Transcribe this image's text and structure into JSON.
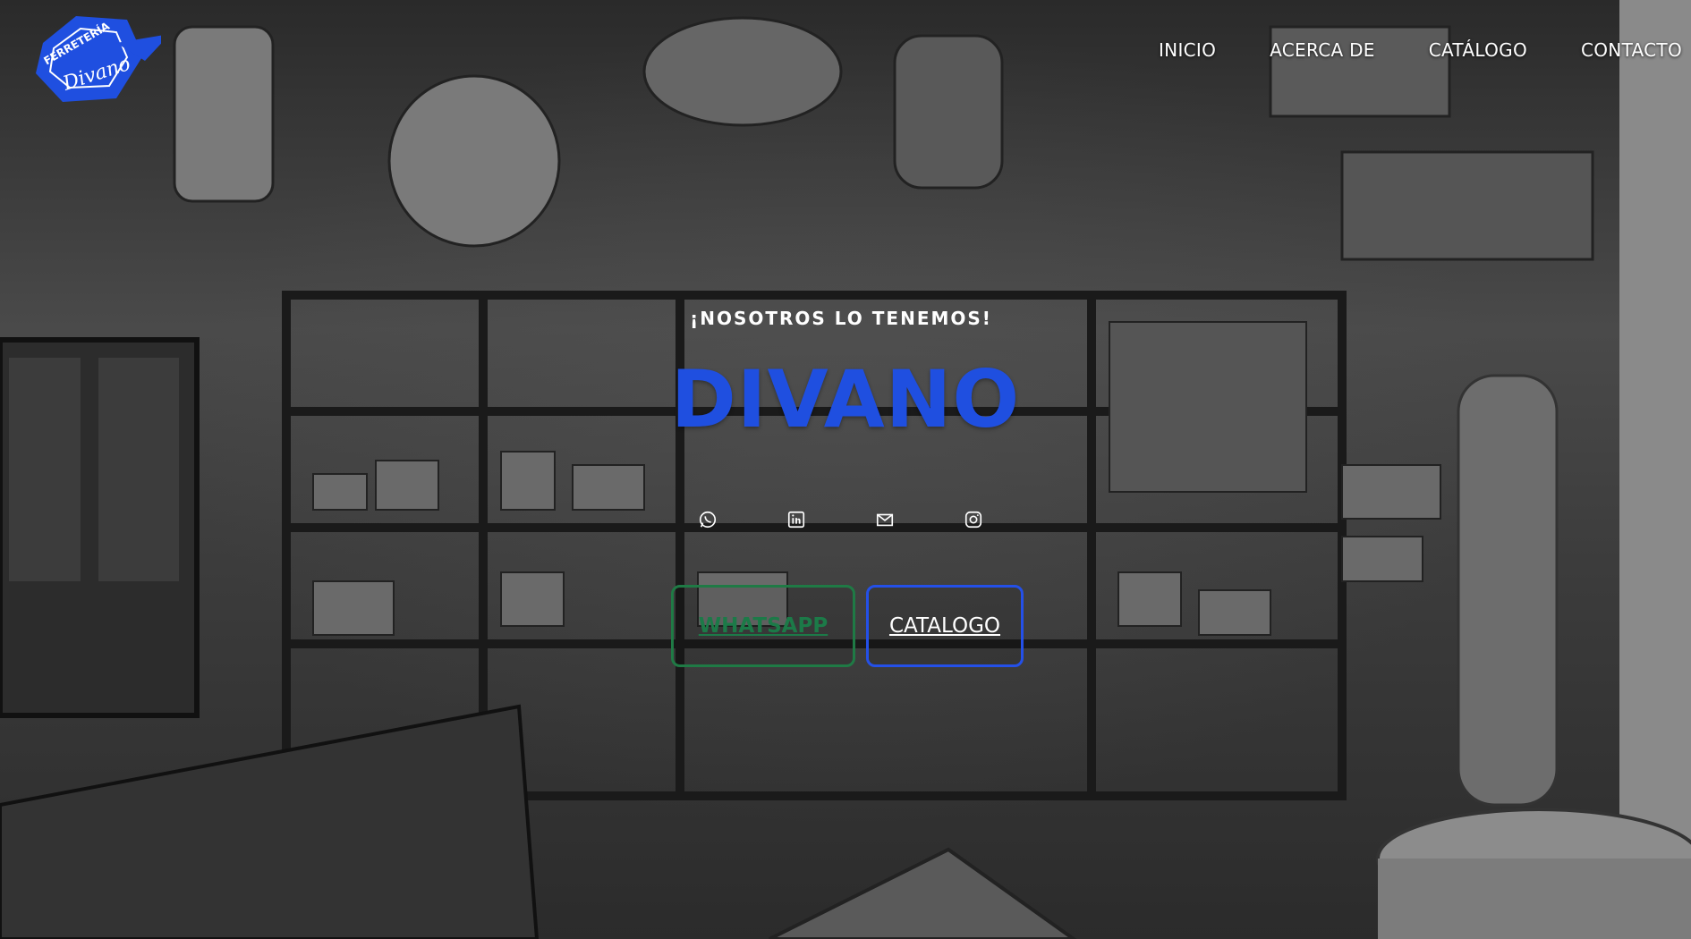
{
  "logo": {
    "top_text": "FERRETERÍA",
    "script_text": "Divano",
    "color": "#1f4fe0"
  },
  "nav": {
    "items": [
      {
        "label": "INICIO"
      },
      {
        "label": "ACERCA DE"
      },
      {
        "label": "CATÁLOGO"
      },
      {
        "label": "CONTACTO"
      }
    ]
  },
  "hero": {
    "tagline": "¡NOSOTROS LO TENEMOS!",
    "brand": "DIVANO",
    "brand_color": "#1f4fe0",
    "socials": [
      {
        "icon": "whatsapp-icon"
      },
      {
        "icon": "linkedin-icon"
      },
      {
        "icon": "mail-icon"
      },
      {
        "icon": "instagram-icon"
      }
    ],
    "buttons": {
      "whatsapp_label": "WHATSAPP",
      "whatsapp_color": "#1f7a45",
      "catalogo_label": "CATALOGO",
      "catalogo_color": "#2450e8"
    }
  }
}
